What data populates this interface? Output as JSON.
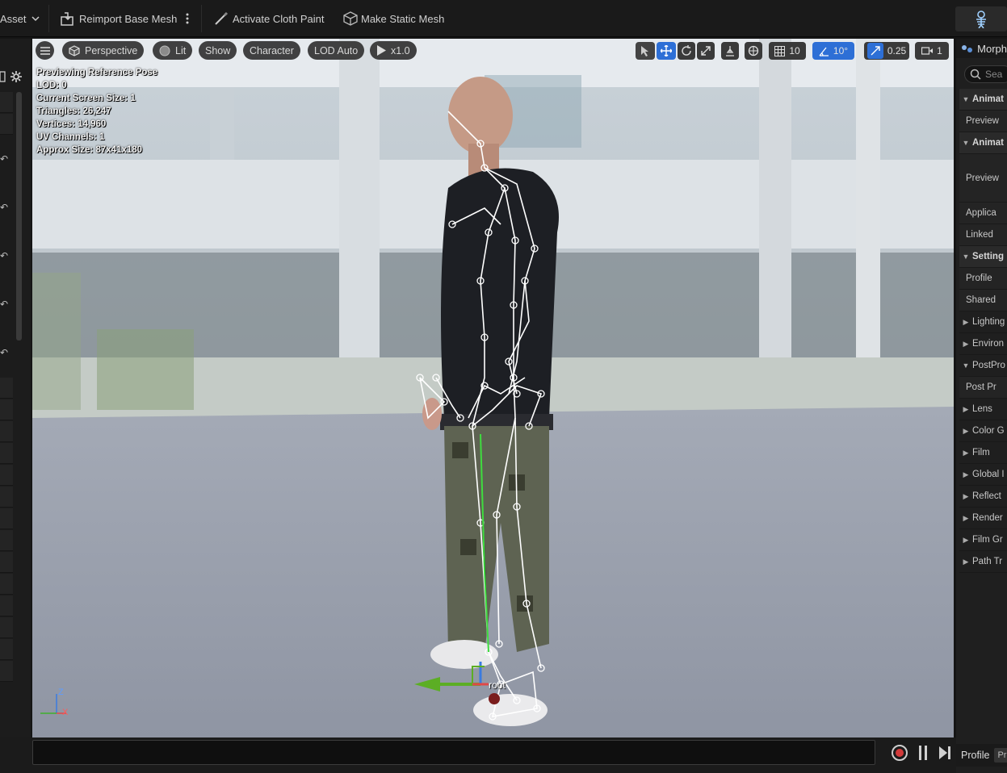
{
  "toolbar": {
    "asset_label": "Asset",
    "reimport_label": "Reimport Base Mesh",
    "cloth_paint_label": "Activate Cloth Paint",
    "static_mesh_label": "Make Static Mesh",
    "right_icon": "skeleton-icon"
  },
  "viewport": {
    "perspective_label": "Perspective",
    "lit_label": "Lit",
    "show_label": "Show",
    "character_label": "Character",
    "lod_label": "LOD Auto",
    "play_speed": "x1.0",
    "grid_snap": "10",
    "rotation_snap": "10°",
    "scale_snap": "0.25",
    "camera_speed": "1",
    "stats": {
      "line1": "Previewing Reference Pose",
      "line2": "LOD: 0",
      "line3": "Current Screen Size: 1",
      "line4": "Triangles: 26,247",
      "line5": "Vertices: 14,960",
      "line6": "UV Channels: 1",
      "line7": "Approx Size: 87x41x180"
    },
    "bone_label": "root",
    "axis_z": "Z",
    "axis_x": "X"
  },
  "right_panel": {
    "tab_label": "Morph",
    "search_placeholder": "Sea",
    "rows": [
      "Animat",
      "Preview",
      "Animat",
      "Preview",
      "Applica",
      "Linked",
      "Setting",
      "Profile",
      "Shared",
      "Lighting",
      "Environ",
      "PostPro",
      "Post Pr",
      "Lens",
      "Color G",
      "Film",
      "Global I",
      "Reflect",
      "Render",
      "Film Gr",
      "Path Tr"
    ],
    "footer_label": "Profile",
    "footer_btn": "Pr"
  },
  "colors": {
    "accent_blue": "#2d6fd6",
    "record_red": "#d23a3a",
    "axis_green": "#3fb02d",
    "axis_red": "#e04848"
  }
}
